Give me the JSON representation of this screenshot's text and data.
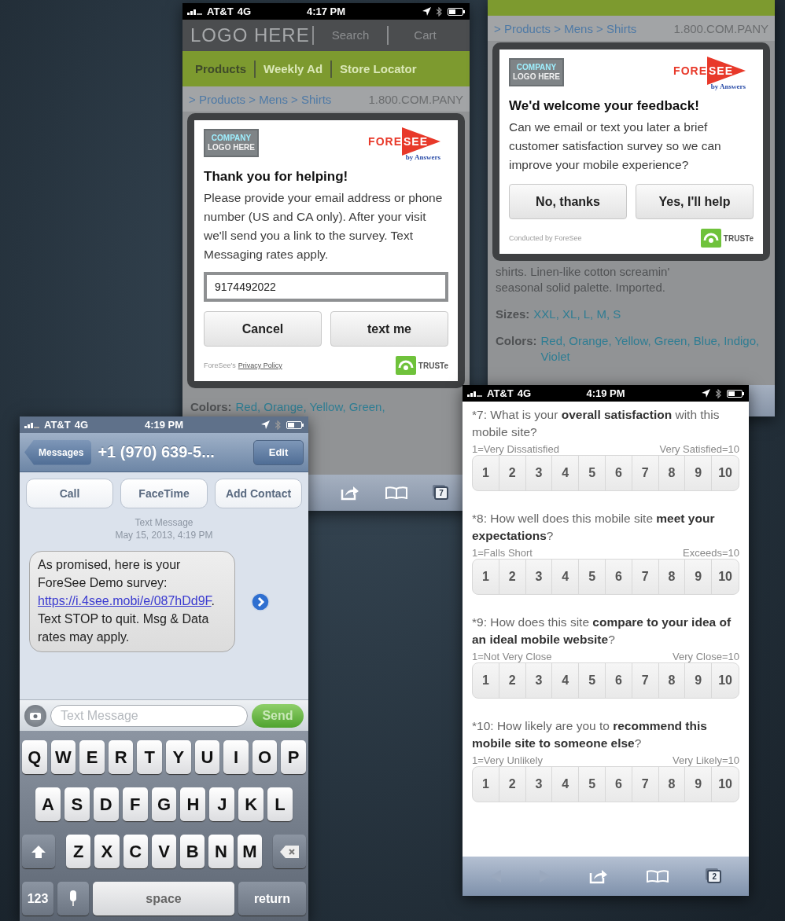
{
  "invite_screen": {
    "status": {
      "carrier": "AT&T",
      "network": "4G",
      "time": "4:17 PM"
    },
    "header": {
      "logo": "LOGO HERE",
      "links": [
        "Search",
        "Cart"
      ]
    },
    "nav": [
      {
        "label": "Products",
        "selected": true
      },
      {
        "label": "Weekly Ad",
        "selected": false
      },
      {
        "label": "Store Locator",
        "selected": false
      }
    ],
    "breadcrumb": "> Products > Mens > Shirts",
    "phone_number": "1.800.COM.PANY",
    "modal": {
      "company_logo": [
        "COMPANY",
        "LOGO HERE"
      ],
      "brand": {
        "wordmark": "FORE",
        "mark": "SEE",
        "tagline": "by Answers"
      },
      "title": "Thank you for helping!",
      "body": "Please provide your email address or phone number (US and CA only). After your visit we'll send you a link to the survey. Text Messaging rates apply.",
      "input": {
        "value": "9174492022"
      },
      "buttons": [
        "Cancel",
        "text me"
      ],
      "footer": {
        "prefix": "ForeSee's",
        "link": "Privacy Policy"
      },
      "seal": "TRUSTe"
    },
    "attributes": [
      {
        "label": "Colors:",
        "value": "Red, Orange, Yellow, Green,"
      }
    ],
    "toolbar": {
      "tabs_count": "7"
    }
  },
  "feedback_screen": {
    "breadcrumb": "> Products > Mens > Shirts",
    "phone_number": "1.800.COM.PANY",
    "modal": {
      "company_logo": [
        "COMPANY",
        "LOGO HERE"
      ],
      "brand": {
        "wordmark": "FORE",
        "mark": "SEE",
        "tagline": "by Answers"
      },
      "title": "We'd welcome your feedback!",
      "body": "Can we email or text you later a brief customer satisfaction survey so we can improve your mobile experience?",
      "buttons": [
        "No, thanks",
        "Yes, I'll help"
      ],
      "footer": {
        "prefix": "Conducted by ForeSee"
      },
      "seal": "TRUSTe"
    },
    "description": [
      "shirts. Linen-like cotton screamin'",
      "seasonal solid palette. Imported."
    ],
    "attributes": [
      {
        "label": "Sizes:",
        "value": "XXL, XL, L, M, S"
      },
      {
        "label": "Colors:",
        "value": "Red, Orange, Yellow, Green, Blue, Indigo, Violet"
      }
    ]
  },
  "sms_screen": {
    "status": {
      "carrier": "AT&T",
      "network": "4G",
      "time": "4:19 PM"
    },
    "back": "Messages",
    "title": "+1 (970) 639-5...",
    "edit": "Edit",
    "actions": [
      "Call",
      "FaceTime",
      "Add Contact"
    ],
    "thread_label": "Text Message",
    "timestamp": "May 15, 2013, 4:19 PM",
    "message": {
      "before": "As promised, here is your ForeSee Demo survey:",
      "link": "https://i.4see.mobi/e/087hDd9F",
      "after": ". Text STOP to quit. Msg & Data rates may apply."
    },
    "input": {
      "placeholder": "Text Message"
    },
    "send": "Send",
    "keyboard": {
      "rows": [
        [
          "Q",
          "W",
          "E",
          "R",
          "T",
          "Y",
          "U",
          "I",
          "O",
          "P"
        ],
        [
          "A",
          "S",
          "D",
          "F",
          "G",
          "H",
          "J",
          "K",
          "L"
        ],
        [
          "Z",
          "X",
          "C",
          "V",
          "B",
          "N",
          "M"
        ]
      ],
      "number_key": "123",
      "space_key": "space",
      "return_key": "return"
    }
  },
  "survey_screen": {
    "status": {
      "carrier": "AT&T",
      "network": "4G",
      "time": "4:19 PM"
    },
    "questions": [
      {
        "text": "*7: What is your **overall satisfaction** with this mobile site?",
        "low": "1=Very Dissatisfied",
        "high": "Very Satisfied=10",
        "options": [
          "1",
          "2",
          "3",
          "4",
          "5",
          "6",
          "7",
          "8",
          "9",
          "10"
        ]
      },
      {
        "text": "*8: How well does this mobile site **meet your expectations**?",
        "low": "1=Falls Short",
        "high": "Exceeds=10",
        "options": [
          "1",
          "2",
          "3",
          "4",
          "5",
          "6",
          "7",
          "8",
          "9",
          "10"
        ]
      },
      {
        "text": "*9: How does this site **compare to your idea of an ideal mobile website**?",
        "low": "1=Not Very Close",
        "high": "Very Close=10",
        "options": [
          "1",
          "2",
          "3",
          "4",
          "5",
          "6",
          "7",
          "8",
          "9",
          "10"
        ]
      },
      {
        "text": "*10: How likely are you to **recommend this mobile site to someone else**?",
        "low": "1=Very Unlikely",
        "high": "Very Likely=10",
        "options": [
          "1",
          "2",
          "3",
          "4",
          "5",
          "6",
          "7",
          "8",
          "9",
          "10"
        ]
      }
    ],
    "toolbar": {
      "tabs_count": "2"
    }
  }
}
